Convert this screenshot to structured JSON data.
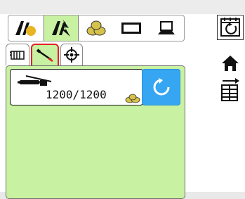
{
  "top_bar": {
    "modes": [
      {
        "icon": "tractor-outline-icon",
        "active": false
      },
      {
        "icon": "tractor-sprayer-icon",
        "active": true
      },
      {
        "icon": "seed-bags-icon",
        "active": false
      },
      {
        "icon": "monitor-icon",
        "active": false
      },
      {
        "icon": "laptop-icon",
        "active": false
      }
    ]
  },
  "tabs": [
    {
      "icon": "heating-grid-icon",
      "active": false
    },
    {
      "icon": "sprayer-wand-icon",
      "active": true
    },
    {
      "icon": "crosshair-target-icon",
      "active": false
    }
  ],
  "tank_card": {
    "icon": "sprayer-tank-icon",
    "value": "1200/1200",
    "unit_icon": "seed-pile-icon"
  },
  "reset_button": {
    "icon": "refresh-icon"
  },
  "right_column": [
    {
      "icon": "calendar-refresh-icon"
    },
    {
      "icon": "home-icon"
    },
    {
      "icon": "table-export-icon"
    }
  ],
  "colors": {
    "panel_green": "#c8f2a2",
    "accent_blue": "#36a6f3",
    "active_tab_border": "#e22222"
  }
}
